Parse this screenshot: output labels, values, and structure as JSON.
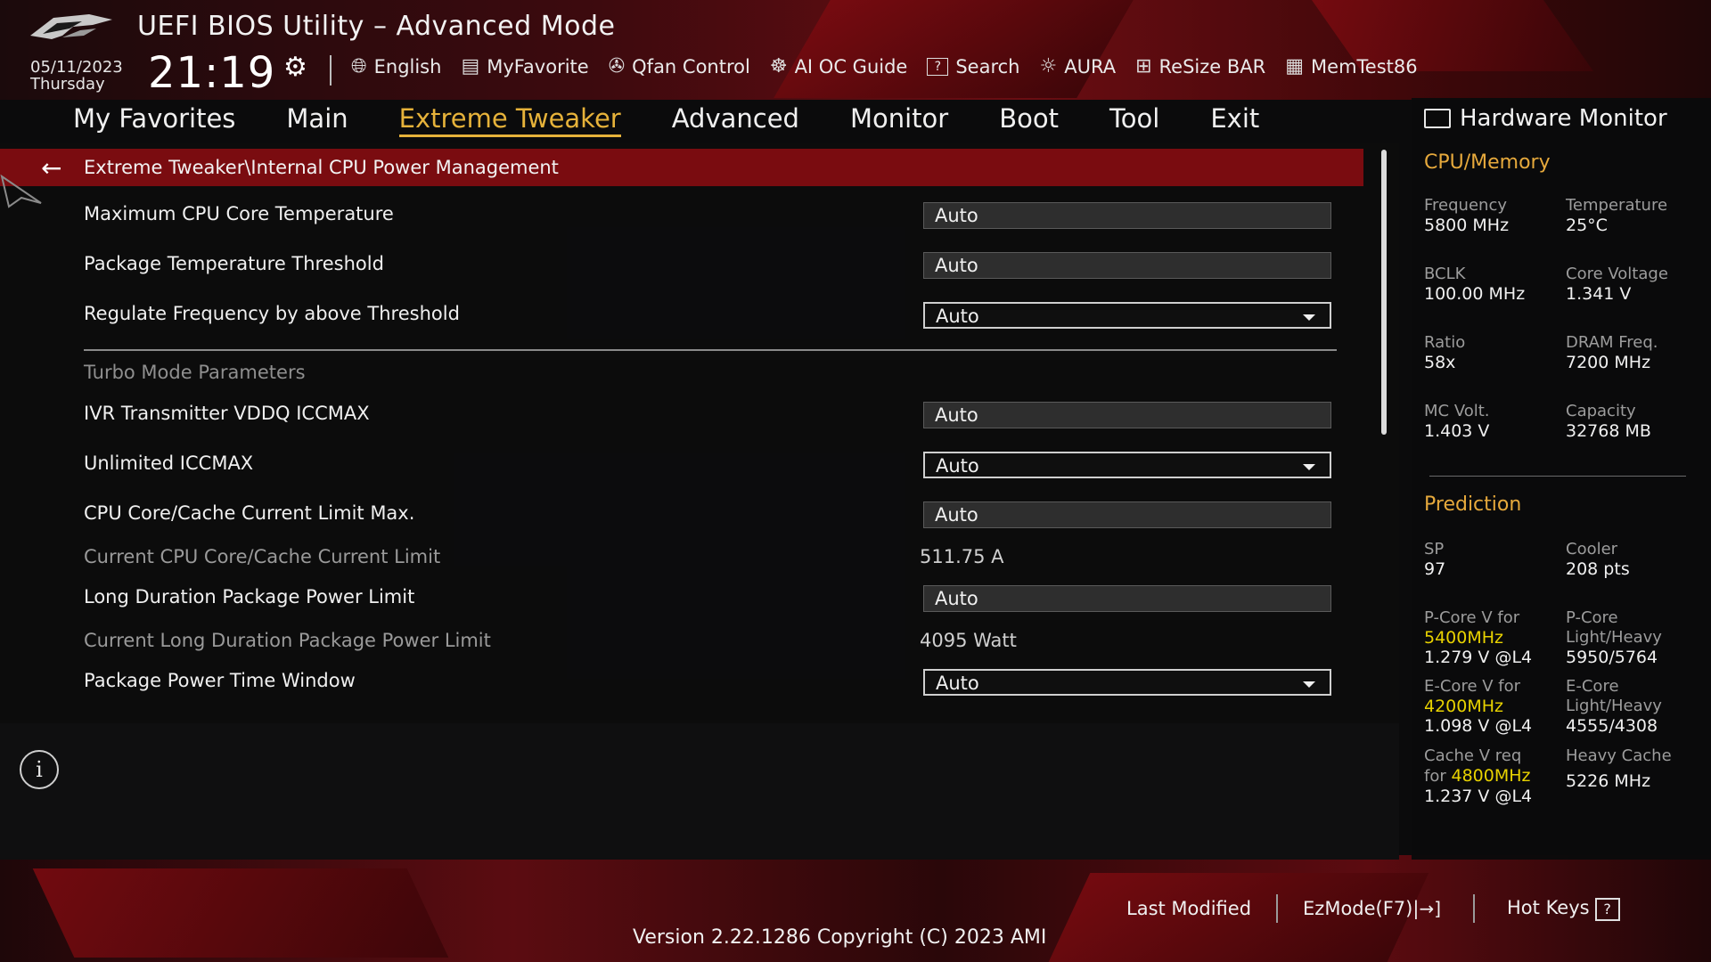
{
  "header": {
    "title": "UEFI BIOS Utility – Advanced Mode",
    "date": "05/11/2023",
    "day": "Thursday",
    "time": "21:19"
  },
  "toolbar": [
    {
      "label": "English",
      "icon": "globe-icon"
    },
    {
      "label": "MyFavorite",
      "icon": "favorite-icon"
    },
    {
      "label": "Qfan Control",
      "icon": "fan-icon"
    },
    {
      "label": "AI OC Guide",
      "icon": "oc-guide-icon"
    },
    {
      "label": "Search",
      "icon": "help-search-icon"
    },
    {
      "label": "AURA",
      "icon": "aura-icon"
    },
    {
      "label": "ReSize BAR",
      "icon": "resize-bar-icon"
    },
    {
      "label": "MemTest86",
      "icon": "memtest-icon"
    }
  ],
  "nav": [
    {
      "label": "My Favorites"
    },
    {
      "label": "Main"
    },
    {
      "label": "Extreme Tweaker",
      "active": true
    },
    {
      "label": "Advanced"
    },
    {
      "label": "Monitor"
    },
    {
      "label": "Boot"
    },
    {
      "label": "Tool"
    },
    {
      "label": "Exit"
    }
  ],
  "breadcrumb": "Extreme Tweaker\\Internal CPU Power Management",
  "settings": {
    "max_cpu_core_temp": {
      "label": "Maximum CPU Core Temperature",
      "value": "Auto"
    },
    "pkg_temp_threshold": {
      "label": "Package Temperature Threshold",
      "value": "Auto"
    },
    "regulate_freq": {
      "label": "Regulate Frequency by above Threshold",
      "value": "Auto"
    },
    "section_turbo": "Turbo Mode Parameters",
    "ivr_vddq": {
      "label": "IVR Transmitter VDDQ ICCMAX",
      "value": "Auto"
    },
    "unlimited_iccmax": {
      "label": "Unlimited ICCMAX",
      "value": "Auto"
    },
    "core_cache_limit": {
      "label": "CPU Core/Cache Current Limit Max.",
      "value": "Auto"
    },
    "current_core_cache": {
      "label": "Current CPU Core/Cache Current Limit",
      "value": "511.75 A"
    },
    "long_duration": {
      "label": "Long Duration Package Power Limit",
      "value": "Auto"
    },
    "current_long_duration": {
      "label": "Current Long Duration Package Power Limit",
      "value": "4095 Watt"
    },
    "pkg_time_window": {
      "label": "Package Power Time Window",
      "value": "Auto"
    }
  },
  "hw": {
    "title": "Hardware Monitor",
    "cpu_mem_title": "CPU/Memory",
    "frequency": {
      "label": "Frequency",
      "value": "5800 MHz"
    },
    "temperature": {
      "label": "Temperature",
      "value": "25°C"
    },
    "bclk": {
      "label": "BCLK",
      "value": "100.00 MHz"
    },
    "core_voltage": {
      "label": "Core Voltage",
      "value": "1.341 V"
    },
    "ratio": {
      "label": "Ratio",
      "value": "58x"
    },
    "dram_freq": {
      "label": "DRAM Freq.",
      "value": "7200 MHz"
    },
    "mc_volt": {
      "label": "MC Volt.",
      "value": "1.403 V"
    },
    "capacity": {
      "label": "Capacity",
      "value": "32768 MB"
    },
    "prediction_title": "Prediction",
    "sp": {
      "label": "SP",
      "value": "97"
    },
    "cooler": {
      "label": "Cooler",
      "value": "208 pts"
    },
    "pcore_v_label": "P-Core V for",
    "pcore_v_freq": "5400MHz",
    "pcore_v_value": "1.279 V @L4",
    "pcore_lh_label1": "P-Core",
    "pcore_lh_label2": "Light/Heavy",
    "pcore_lh_value": "5950/5764",
    "ecore_v_label": "E-Core V for",
    "ecore_v_freq": "4200MHz",
    "ecore_v_value": "1.098 V @L4",
    "ecore_lh_label1": "E-Core",
    "ecore_lh_label2": "Light/Heavy",
    "ecore_lh_value": "4555/4308",
    "cache_v_label1": "Cache V req",
    "cache_v_label2": "for",
    "cache_v_freq": "4800MHz",
    "cache_v_value": "1.237 V @L4",
    "heavy_cache_label": "Heavy Cache",
    "heavy_cache_value": "5226 MHz"
  },
  "footer": {
    "last_modified": "Last Modified",
    "ezmode": "EzMode(F7)|",
    "hotkeys": "Hot Keys",
    "version": "Version 2.22.1286 Copyright (C) 2023 AMI"
  },
  "colors": {
    "accent": "#e6b23a",
    "breadcrumb_bg": "#7a0c10",
    "prediction_highlight": "#e8d200"
  }
}
